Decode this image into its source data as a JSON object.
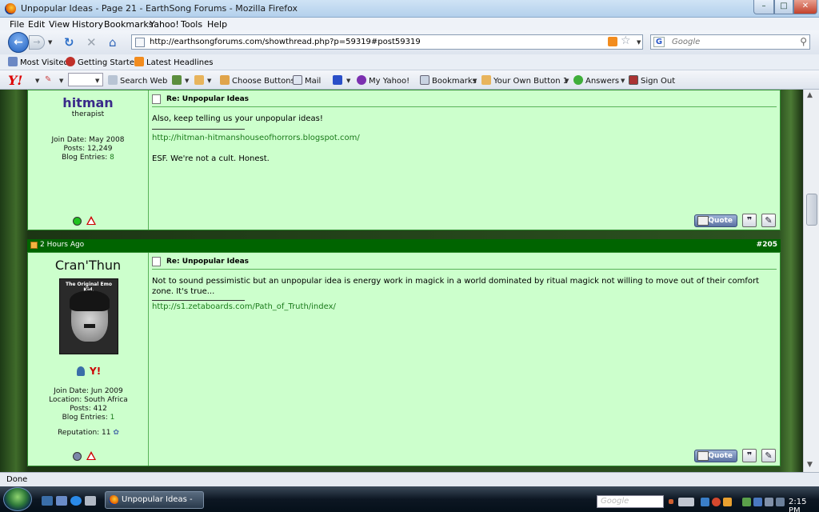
{
  "window": {
    "title": "Unpopular Ideas - Page 21 - EarthSong Forums - Mozilla Firefox"
  },
  "menu": [
    "File",
    "Edit",
    "View",
    "History",
    "Bookmarks",
    "Yahoo!",
    "Tools",
    "Help"
  ],
  "nav": {
    "url": "http://earthsongforums.com/showthread.php?p=59319#post59319",
    "search_placeholder": "Google"
  },
  "bookmarks": [
    "Most Visited",
    "Getting Started",
    "Latest Headlines"
  ],
  "yahoo_toolbar": {
    "logo": "Y!",
    "items": [
      "Search Web",
      "Choose Buttons",
      "Mail",
      "My Yahoo!",
      "Bookmarks",
      "Your Own Button 1",
      "Answers",
      "Sign Out"
    ]
  },
  "posts": [
    {
      "username": "hitman",
      "user_title": "therapist",
      "join_date": "Join Date: May 2008",
      "posts": "Posts: 12,249",
      "blog_label": "Blog Entries: ",
      "blog_count": "8",
      "post_title": "Re: Unpopular Ideas",
      "body": "Also, keep telling us your unpopular ideas!",
      "sig_link": "http://hitman-hitmanshouseofhorrors.blogspot.com/",
      "sig_text": "ESF. We're not a cult. Honest.",
      "quote_label": "Quote"
    },
    {
      "header_time": "2 Hours Ago",
      "header_num": "#205",
      "username": "Cran'Thun",
      "avatar_caption": "The Original Emo Kid.",
      "join_date": "Join Date: Jun 2009",
      "location": "Location: South Africa",
      "posts": "Posts: 412",
      "blog_label": "Blog Entries: ",
      "blog_count": "1",
      "reputation": "Reputation: 11",
      "post_title": "Re: Unpopular Ideas",
      "body": "Not to sound pessimistic but an unpopular idea is energy work in magick in a world dominated by ritual magick not willing to move out of their comfort zone. It's true...",
      "sig_link": "http://s1.zetaboards.com/Path_of_Truth/index/",
      "quote_label": "Quote"
    }
  ],
  "status": "Done",
  "taskbar": {
    "task_label": "Unpopular Ideas - P...",
    "search_text": "Google",
    "clock": "2:15 PM"
  },
  "colors": {
    "post_bg": "#ccffcc",
    "post_header": "#006400",
    "link": "#1a7a1a",
    "username": "#3a2a8a"
  }
}
